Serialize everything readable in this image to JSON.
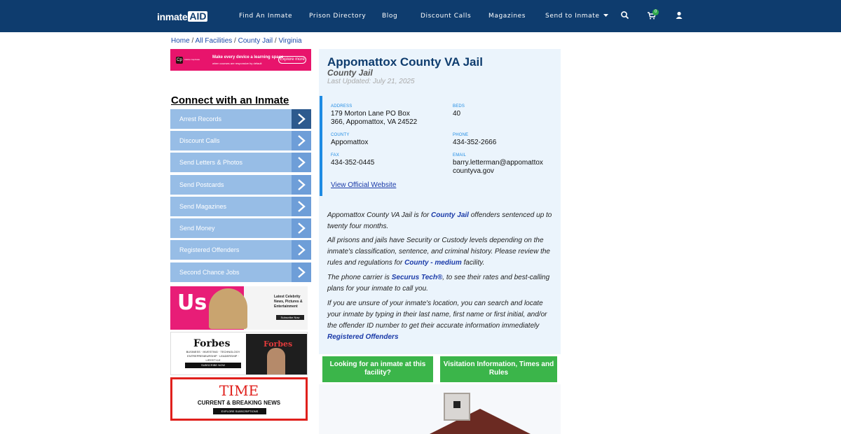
{
  "nav": {
    "logo_main": "inmate",
    "logo_box": "AID",
    "links": [
      "Find An Inmate",
      "Prison Directory",
      "Blog",
      "Discount Calls",
      "Magazines",
      "Send to Inmate"
    ],
    "cart_count": "0"
  },
  "breadcrumb": {
    "home": "Home",
    "all": "All Facilities",
    "type": "County Jail",
    "state": "Virginia",
    "sep": " / "
  },
  "ads": {
    "top_brand": "Cp",
    "top_brand_name": "Adobe Captivate",
    "top_text": "Make every device a learning space",
    "top_subtext": "when courses are responsive by default",
    "top_button": "Explore more",
    "us_logo": "Us",
    "us_text": "Latest Celebrity News, Pictures & Entertainment",
    "us_button": "Subscribe Now",
    "forbes_name": "Forbes",
    "forbes_tag": "BUSINESS · INVESTING · TECHNOLOGY ENTREPRENEURSHIP · LEADERSHIP · LIFESTYLE",
    "forbes_button": "SUBSCRIBE NOW",
    "forbes_cover": "Forbes",
    "time_title": "TIME",
    "time_sub": "CURRENT & BREAKING NEWS",
    "time_button": "EXPLORE SUBSCRIPTIONS"
  },
  "sidebar": {
    "title": "Connect with an Inmate",
    "items": [
      "Arrest Records",
      "Discount Calls",
      "Send Letters & Photos",
      "Send Postcards",
      "Send Magazines",
      "Send Money",
      "Registered Offenders",
      "Second Chance Jobs"
    ]
  },
  "facility": {
    "name": "Appomattox County VA Jail",
    "type": "County Jail",
    "updated": "Last Updated: July 21, 2025",
    "address_label": "ADDRESS",
    "address_line1": "179 Morton Lane PO Box",
    "address_line2": "366, Appomattox, VA 24522",
    "beds_label": "BEDS",
    "beds": "40",
    "county_label": "COUNTY",
    "county": "Appomattox",
    "phone_label": "PHONE",
    "phone": "434-352-2666",
    "fax_label": "FAX",
    "fax": "434-352-0445",
    "email_label": "EMAIL",
    "email_line1": "barry.letterman@appomattox",
    "email_line2": "countyva.gov",
    "website_link": "View Official Website"
  },
  "description": {
    "p1_a": "Appomattox County VA Jail is for ",
    "p1_link": "County Jail",
    "p1_b": " offenders sentenced up to twenty four months.",
    "p2_a": "All prisons and jails have Security or Custody levels depending on the inmate's classification, sentence, and criminal history. Please review the rules and regulations for ",
    "p2_link": "County - medium",
    "p2_b": " facility.",
    "p3_a": "The phone carrier is ",
    "p3_link": "Securus Tech®",
    "p3_b": ", to see their rates and best-calling plans for your inmate to call you.",
    "p4_a": "If you are unsure of your inmate's location, you can search and locate your inmate by typing in their last name, first name or first initial, and/or the offender ID number to get their accurate information immediately ",
    "p4_link": "Registered Offenders"
  },
  "buttons": {
    "looking": "Looking for an inmate at this facility?",
    "visitation": "Visitation Information, Times and Rules"
  },
  "colors": {
    "nav_bg": "#0e3c6e",
    "panel_bg": "#ebf4fc",
    "accent": "#1e8be3",
    "green": "#3bb54a",
    "sidebar": "#97bde6"
  },
  "icons": [
    "search-icon",
    "cart-icon",
    "user-icon",
    "caret-down-icon",
    "chevron-right-icon"
  ]
}
